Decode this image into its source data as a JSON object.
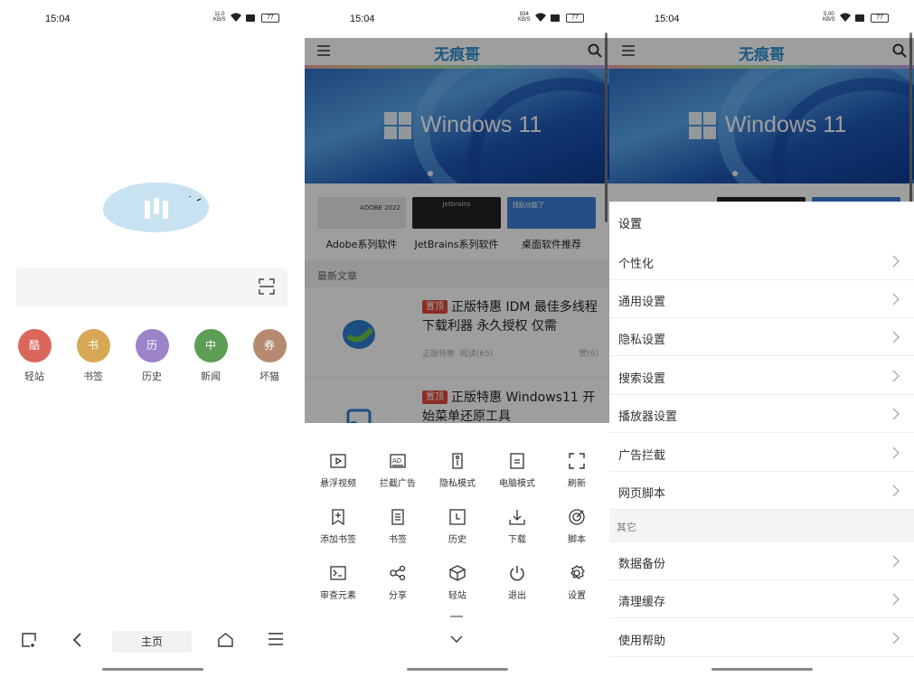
{
  "status": [
    {
      "time": "15:04",
      "net": "11.0",
      "unit": "KB/S",
      "battery": "77"
    },
    {
      "time": "15:04",
      "net": "834",
      "unit": "KB/S",
      "battery": "77"
    },
    {
      "time": "15:04",
      "net": "5.00",
      "unit": "KB/S",
      "battery": "77"
    }
  ],
  "home": {
    "quick_links": [
      {
        "glyph": "酷",
        "label": "轻站",
        "color": "#d9675c"
      },
      {
        "glyph": "书",
        "label": "书签",
        "color": "#d7a853"
      },
      {
        "glyph": "历",
        "label": "历史",
        "color": "#9b82c9"
      },
      {
        "glyph": "中",
        "label": "新闻",
        "color": "#5c9e55"
      },
      {
        "glyph": "券",
        "label": "坏猫",
        "color": "#b58a70"
      }
    ],
    "home_label": "主页"
  },
  "site": {
    "title": "无痕哥",
    "banner_text": "Windows 11",
    "categories": [
      {
        "label": "Adobe系列软件",
        "thumb_text": "ADOBE 2022",
        "color": "#e8e8e8"
      },
      {
        "label": "JetBrains系列软件",
        "thumb_text": "Jetbrains",
        "color": "#222222"
      },
      {
        "label": "桌面软件推荐",
        "thumb_text": "找贴功能了",
        "color": "#3e7ed6"
      }
    ],
    "section_label": "最新文章",
    "articles": [
      {
        "tag": "置顶",
        "title": "正版特惠 IDM 最佳多线程下载利器 永久授权 仅需",
        "author": "正版特惠",
        "views": "阅读(65)",
        "likes": "赞(6)"
      },
      {
        "tag": "置顶",
        "title": "正版特惠 Windows11 开始菜单还原工具",
        "author": "",
        "views": "",
        "likes": ""
      }
    ]
  },
  "menu_sheet": {
    "tools": [
      {
        "icon": "pip-video-icon",
        "label": "悬浮视频"
      },
      {
        "icon": "ad-block-icon",
        "label": "拦截广告"
      },
      {
        "icon": "incognito-icon",
        "label": "隐私模式"
      },
      {
        "icon": "desktop-mode-icon",
        "label": "电脑模式"
      },
      {
        "icon": "refresh-icon",
        "label": "刷新"
      },
      {
        "icon": "add-bookmark-icon",
        "label": "添加书签"
      },
      {
        "icon": "bookmarks-icon",
        "label": "书签"
      },
      {
        "icon": "history-icon",
        "label": "历史"
      },
      {
        "icon": "download-icon",
        "label": "下载"
      },
      {
        "icon": "script-icon",
        "label": "脚本"
      },
      {
        "icon": "inspect-icon",
        "label": "审查元素"
      },
      {
        "icon": "share-icon",
        "label": "分享"
      },
      {
        "icon": "lite-site-icon",
        "label": "轻站"
      },
      {
        "icon": "power-icon",
        "label": "退出"
      },
      {
        "icon": "settings-icon",
        "label": "设置"
      }
    ]
  },
  "settings": {
    "title": "设置",
    "items": [
      "个性化",
      "通用设置",
      "隐私设置",
      "搜索设置",
      "播放器设置",
      "广告拦截",
      "网页脚本"
    ],
    "other_header": "其它",
    "other_items": [
      "数据备份",
      "清理缓存",
      "使用帮助"
    ]
  }
}
